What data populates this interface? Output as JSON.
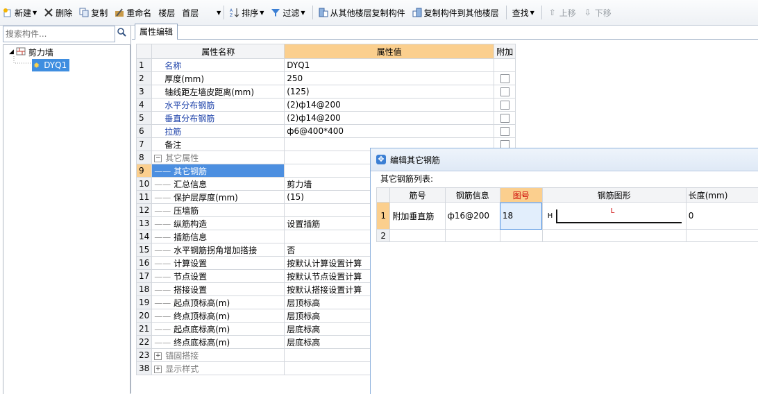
{
  "toolbar": {
    "new_label": "新建",
    "delete_label": "删除",
    "copy_label": "复制",
    "rename_label": "重命名",
    "floor_label": "楼层",
    "floor_value": "首层",
    "sort_label": "排序",
    "filter_label": "过滤",
    "copy_from_other_floor_label": "从其他楼层复制构件",
    "copy_to_other_floor_label": "复制构件到其他楼层",
    "find_label": "查找",
    "move_up_label": "上移",
    "move_down_label": "下移"
  },
  "left_panel": {
    "search_placeholder": "搜索构件...",
    "tree": {
      "root": "剪力墙",
      "child": "DYQ1"
    }
  },
  "tab": {
    "label": "属性编辑"
  },
  "properties": {
    "headers": {
      "name": "属性名称",
      "value": "属性值",
      "extra": "附加"
    },
    "rows": [
      {
        "num": "1",
        "name": "名称",
        "value": "DYQ1"
      },
      {
        "num": "2",
        "name": "厚度(mm)",
        "value": "250"
      },
      {
        "num": "3",
        "name": "轴线距左墙皮距离(mm)",
        "value": "(125)"
      },
      {
        "num": "4",
        "name": "水平分布钢筋",
        "value": "(2)ф14@200"
      },
      {
        "num": "5",
        "name": "垂直分布钢筋",
        "value": "(2)ф14@200"
      },
      {
        "num": "6",
        "name": "拉筋",
        "value": "ф6@400*400"
      },
      {
        "num": "7",
        "name": "备注",
        "value": ""
      },
      {
        "num": "8",
        "name": "其它属性",
        "value": ""
      },
      {
        "num": "9",
        "name": "其它钢筋",
        "value": ""
      },
      {
        "num": "10",
        "name": "汇总信息",
        "value": "剪力墙"
      },
      {
        "num": "11",
        "name": "保护层厚度(mm)",
        "value": "(15)"
      },
      {
        "num": "12",
        "name": "压墙筋",
        "value": ""
      },
      {
        "num": "13",
        "name": "纵筋构造",
        "value": "设置插筋"
      },
      {
        "num": "14",
        "name": "插筋信息",
        "value": ""
      },
      {
        "num": "15",
        "name": "水平钢筋拐角增加搭接",
        "value": "否"
      },
      {
        "num": "16",
        "name": "计算设置",
        "value": "按默认计算设置计算"
      },
      {
        "num": "17",
        "name": "节点设置",
        "value": "按默认节点设置计算"
      },
      {
        "num": "18",
        "name": "搭接设置",
        "value": "按默认搭接设置计算"
      },
      {
        "num": "19",
        "name": "起点顶标高(m)",
        "value": "层顶标高"
      },
      {
        "num": "20",
        "name": "终点顶标高(m)",
        "value": "层顶标高"
      },
      {
        "num": "21",
        "name": "起点底标高(m)",
        "value": "层底标高"
      },
      {
        "num": "22",
        "name": "终点底标高(m)",
        "value": "层底标高"
      },
      {
        "num": "23",
        "name": "锚固搭接",
        "value": ""
      },
      {
        "num": "38",
        "name": "显示样式",
        "value": ""
      }
    ]
  },
  "dialog": {
    "title": "编辑其它钢筋",
    "list_label": "其它钢筋列表:",
    "headers": {
      "bar_no": "筋号",
      "bar_info": "钢筋信息",
      "shape_no": "图号",
      "shape": "钢筋图形",
      "length": "长度(mm)"
    },
    "rows": [
      {
        "num": "1",
        "bar_no": "附加垂直筋",
        "bar_info": "ф16@200",
        "shape_no": "18",
        "shape_h": "H",
        "shape_l": "L",
        "length": "0"
      },
      {
        "num": "2",
        "bar_no": "",
        "bar_info": "",
        "shape_no": "",
        "shape_h": "",
        "shape_l": "",
        "length": ""
      }
    ]
  },
  "colors": {
    "header_highlight": "#fbcf8e",
    "selection": "#4c8fe0",
    "blue_text": "#1a3fa8",
    "shape_label": "#cc0000"
  }
}
